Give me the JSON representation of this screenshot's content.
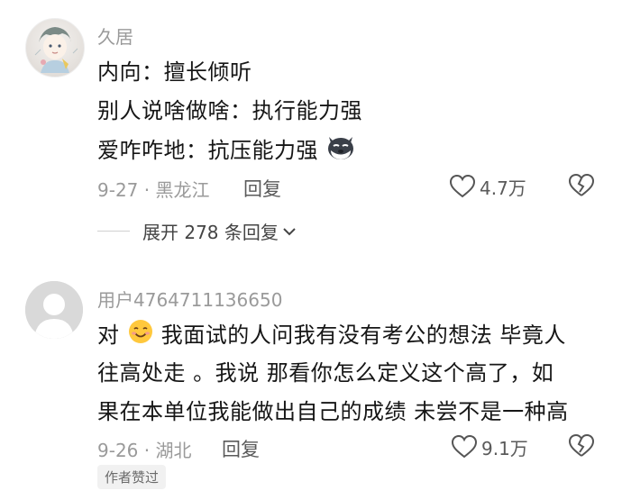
{
  "comments": [
    {
      "username": "久居",
      "lines": [
        "内向：擅长倾听",
        "别人说啥做啥：执行能力强",
        "爱咋咋地：抗压能力强"
      ],
      "date_location": "9-27 · 黑龙江",
      "reply_label": "回复",
      "like_count": "4.7万",
      "expand_label": "展开 278 条回复",
      "avatar_icon": "anime-avatar-icon",
      "trailing_emoji": "husky-dog-emoji-icon"
    },
    {
      "username": "用户4764711136650",
      "line1_prefix": "对",
      "line1_rest": " 我面试的人问我有没有考公的想法 毕竟人",
      "line2": "往高处走 。我说 那看你怎么定义这个高了，如",
      "line3": "果在本单位我能做出自己的成绩 未尝不是一种高",
      "date_location": "9-26 · 湖北",
      "reply_label": "回复",
      "like_count": "9.1万",
      "badge": "作者赞过",
      "avatar_icon": "default-user-avatar-icon",
      "inline_emoji": "smile-emoji-icon"
    }
  ],
  "colors": {
    "secondary_text": "#9a9a9a",
    "primary_text": "#161616",
    "badge_bg": "#f1f1f1"
  }
}
